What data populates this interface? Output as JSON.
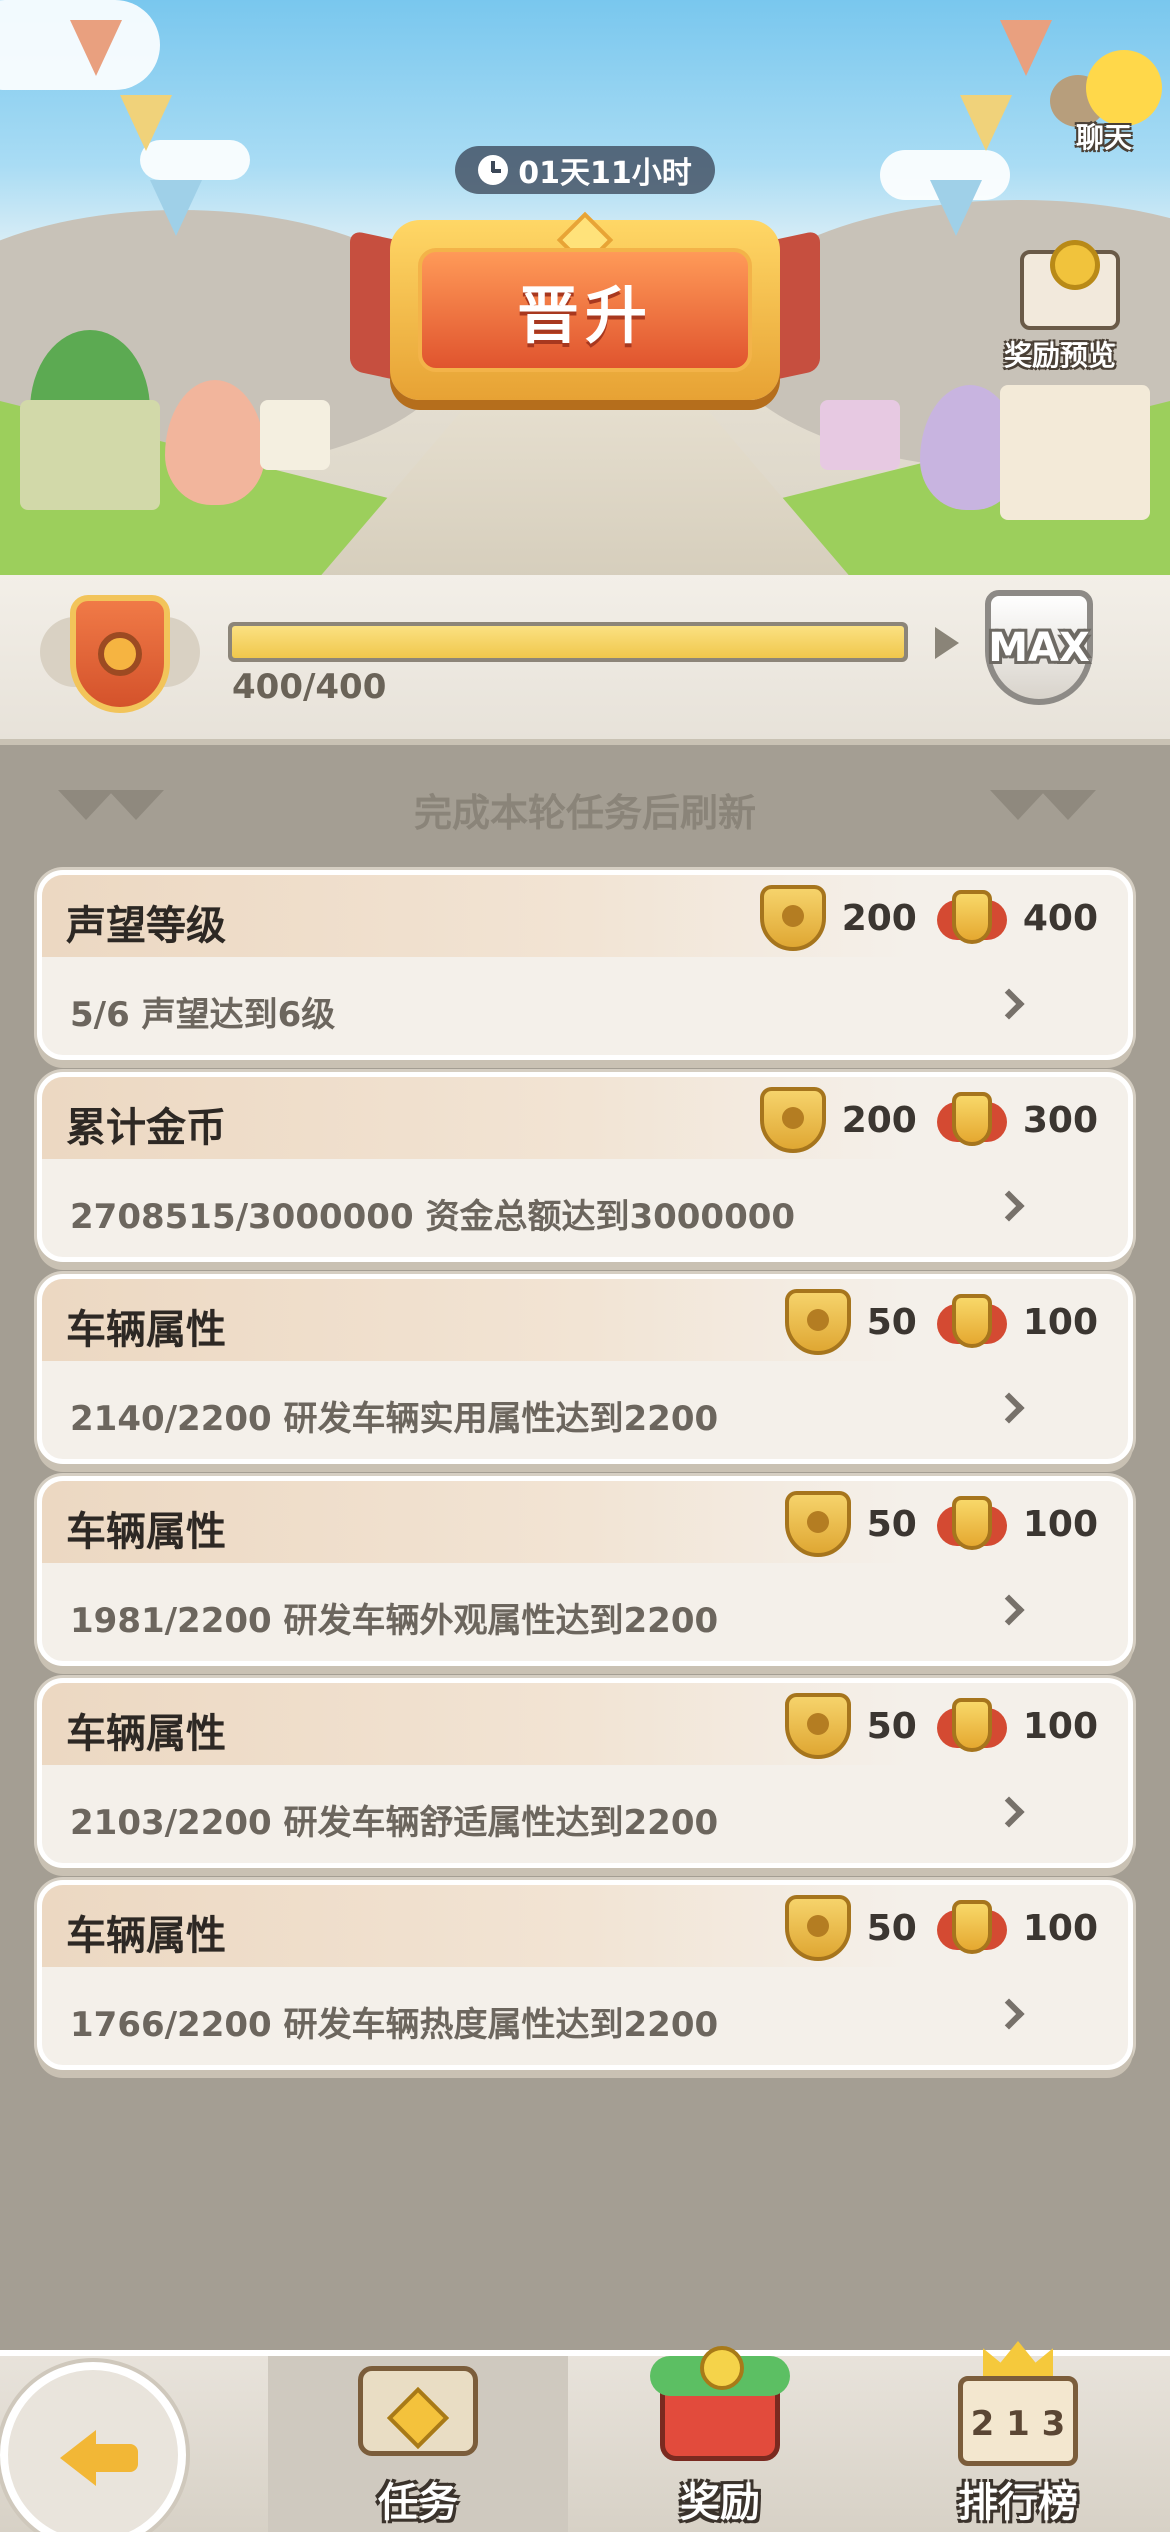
{
  "header": {
    "timer": "01天11小时",
    "title": "晋升",
    "chat_label": "聊天",
    "reward_preview_label": "奖励预览"
  },
  "progress": {
    "current": 400,
    "max": 400,
    "fraction": 1.0,
    "text": "400/400",
    "max_badge": "MAX"
  },
  "list": {
    "refresh_note": "完成本轮任务后刷新"
  },
  "tasks": [
    {
      "title": "声望等级",
      "desc": "5/6  声望达到6级",
      "reward1": "200",
      "reward2": "400"
    },
    {
      "title": "累计金币",
      "desc": "2708515/3000000  资金总额达到3000000",
      "reward1": "200",
      "reward2": "300"
    },
    {
      "title": "车辆属性",
      "desc": "2140/2200  研发车辆实用属性达到2200",
      "reward1": "50",
      "reward2": "100"
    },
    {
      "title": "车辆属性",
      "desc": "1981/2200  研发车辆外观属性达到2200",
      "reward1": "50",
      "reward2": "100"
    },
    {
      "title": "车辆属性",
      "desc": "2103/2200  研发车辆舒适属性达到2200",
      "reward1": "50",
      "reward2": "100"
    },
    {
      "title": "车辆属性",
      "desc": "1766/2200  研发车辆热度属性达到2200",
      "reward1": "50",
      "reward2": "100"
    }
  ],
  "nav": {
    "tab1": "任务",
    "tab2": "奖励",
    "tab3": "排行榜",
    "tab3_rank_digits": "2 1 3"
  },
  "icons": {
    "back": "back-arrow-icon",
    "reward1": "gold-shield-icon",
    "reward2": "red-crest-icon"
  },
  "colors": {
    "progress_fill": "#f0c74c",
    "title_banner": "#e0542e",
    "card_bg": "#f4f0ea",
    "page_bg": "#a49e93"
  }
}
